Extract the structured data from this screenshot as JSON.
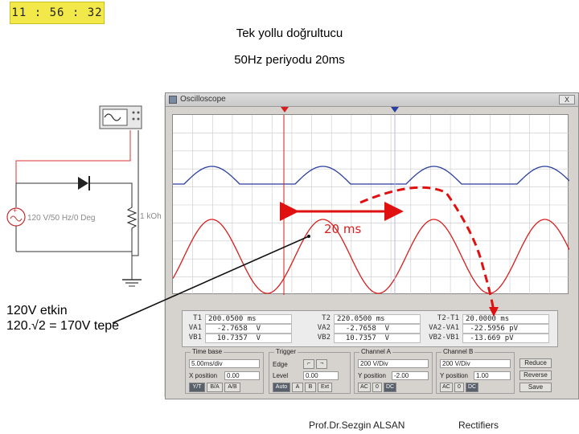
{
  "clock": "11 : 56 : 32",
  "slide": {
    "title_line1": "Tek yollu doğrultucu",
    "title_line2": "50Hz periyodu 20ms"
  },
  "circuit": {
    "source_label": "120 V/50 Hz/0 Deg",
    "resistor_label": "1 kOh"
  },
  "oscilloscope": {
    "window_title": "Oscilloscope",
    "close_label": "X",
    "measure_label": "20 ms",
    "readouts": {
      "t1": {
        "label": "T1",
        "time": "200.0500 ms",
        "va_label": "VA1",
        "va": "  -2.7658  V",
        "vb_label": "VB1",
        "vb": "  10.7357  V"
      },
      "t2": {
        "label": "T2",
        "time": "220.0500 ms",
        "va_label": "VA2",
        "va": "  -2.7658  V",
        "vb_label": "VB2",
        "vb": "  10.7357  V"
      },
      "diff": {
        "label": "T2-T1",
        "time": "20.0000 ms",
        "va_label": "VA2-VA1",
        "va": " -22.5956 pV",
        "vb_label": "VB2-VB1",
        "vb": " -13.669 pV"
      }
    },
    "timebase": {
      "title": "Time base",
      "scale": "5.00ms/div",
      "xpos_label": "X position",
      "xpos": "0.00",
      "buttons": [
        "Y/T",
        "B/A",
        "A/B"
      ]
    },
    "trigger": {
      "title": "Trigger",
      "edge_label": "Edge",
      "level_label": "Level",
      "level": "0.00",
      "buttons": [
        "Auto",
        "A",
        "B",
        "Ext"
      ]
    },
    "channel_a": {
      "title": "Channel A",
      "scale": "200 V/Div",
      "ypos_label": "Y position",
      "ypos": "-2.00",
      "buttons": [
        "AC",
        "0",
        "DC"
      ]
    },
    "channel_b": {
      "title": "Channel B",
      "scale": "200 V/Div",
      "ypos_label": "Y position",
      "ypos": "1.00",
      "buttons": [
        "AC",
        "0",
        "DC"
      ]
    },
    "side_buttons": [
      "Reduce",
      "Reverse",
      "Save"
    ]
  },
  "annotation": {
    "line1": "120V etkin",
    "line2": "120.√2 = 170V tepe"
  },
  "footer": {
    "author": "Prof.Dr.Sezgin ALSAN",
    "topic": "Rectifiers"
  },
  "colors": {
    "channel_a": "#2a3fa0",
    "channel_b": "#d81e1e",
    "accent": "#d81e1e",
    "clock_bg": "#f2e84a"
  }
}
